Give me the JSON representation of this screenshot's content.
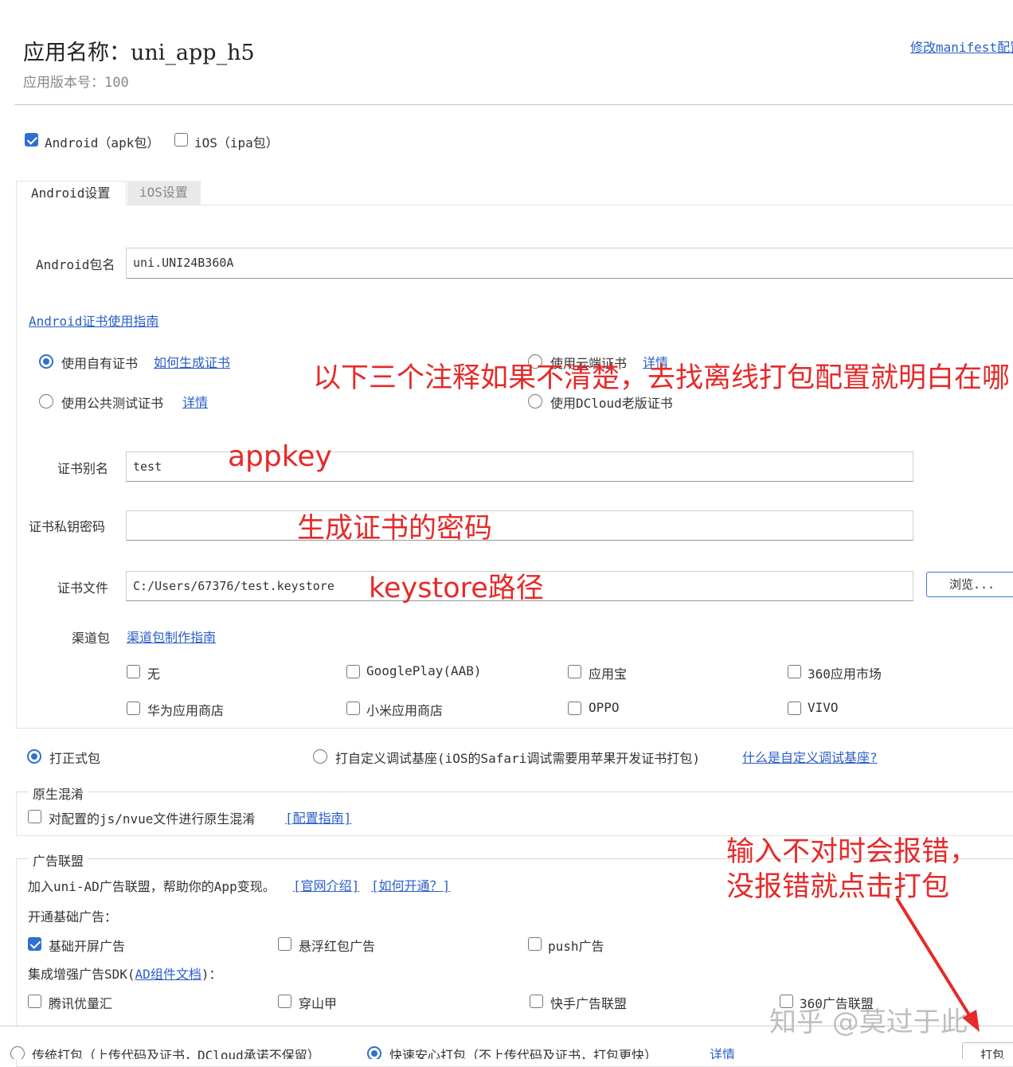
{
  "header": {
    "app_name": "应用名称：uni_app_h5",
    "app_version": "应用版本号：100",
    "manifest_link": "修改manifest配置"
  },
  "platforms": {
    "android_label": "Android（apk包）",
    "android_checked": true,
    "ios_label": "iOS（ipa包）",
    "ios_checked": false
  },
  "tabs": [
    {
      "label": "Android设置",
      "active": true
    },
    {
      "label": "iOS设置",
      "active": false
    }
  ],
  "android": {
    "package_label": "Android包名",
    "package_value": "uni.UNI24B360A",
    "cert_guide_link": "Android证书使用指南",
    "cert_options": {
      "own": {
        "label": "使用自有证书",
        "link": "如何生成证书",
        "selected": true
      },
      "cloud": {
        "label": "使用云端证书",
        "link": "详情",
        "selected": false
      },
      "public": {
        "label": "使用公共测试证书",
        "link": "详情",
        "selected": false
      },
      "dcloud_old": {
        "label": "使用DCloud老版证书",
        "selected": false
      }
    },
    "alias_label": "证书别名",
    "alias_value": "test",
    "password_label": "证书私钥密码",
    "password_value": "",
    "file_label": "证书文件",
    "file_value": "C:/Users/67376/test.keystore",
    "browse_label": "浏览...",
    "channel_label": "渠道包",
    "channel_link": "渠道包制作指南",
    "channels": [
      {
        "label": "无",
        "checked": false
      },
      {
        "label": "GooglePlay(AAB)",
        "checked": false
      },
      {
        "label": "应用宝",
        "checked": false
      },
      {
        "label": "360应用市场",
        "checked": false
      },
      {
        "label": "华为应用商店",
        "checked": false
      },
      {
        "label": "小米应用商店",
        "checked": false
      },
      {
        "label": "OPPO",
        "checked": false
      },
      {
        "label": "VIVO",
        "checked": false
      }
    ]
  },
  "build_type": {
    "formal_label": "打正式包",
    "formal_selected": true,
    "custom_label": "打自定义调试基座(iOS的Safari调试需要用苹果开发证书打包)",
    "custom_selected": false,
    "custom_link": "什么是自定义调试基座?"
  },
  "obfuscation": {
    "legend": "原生混淆",
    "option_label": "对配置的js/nvue文件进行原生混淆",
    "option_checked": false,
    "guide_link": "[配置指南]"
  },
  "ads": {
    "legend": "广告联盟",
    "intro_text": "加入uni-AD广告联盟，帮助你的App变现。",
    "intro_link_1": "[官网介绍]",
    "intro_link_2": "[如何开通？]",
    "basic_label": "开通基础广告：",
    "basic_items": [
      {
        "label": "基础开屏广告",
        "checked": true
      },
      {
        "label": "悬浮红包广告",
        "checked": false
      },
      {
        "label": "push广告",
        "checked": false
      }
    ],
    "sdk_label_pre": "集成增强广告SDK(",
    "sdk_link": "AD组件文档",
    "sdk_label_post": ")：",
    "sdk_items": [
      {
        "label": "腾讯优量汇",
        "checked": false
      },
      {
        "label": "穿山甲",
        "checked": false
      },
      {
        "label": "快手广告联盟",
        "checked": false
      },
      {
        "label": "360广告联盟",
        "checked": false
      }
    ]
  },
  "footer": {
    "traditional_label": "传统打包（上传代码及证书，DCloud承诺不保留）",
    "traditional_selected": false,
    "fast_label": "快速安心打包（不上传代码及证书，打包更快）",
    "fast_selected": true,
    "detail_link": "详情",
    "pack_button": "打包"
  },
  "annotations": {
    "note_top": "以下三个注释如果不清楚，去找离线打包配置就明白在哪",
    "note_appkey": "appkey",
    "note_password": "生成证书的密码",
    "note_keystore": "keystore路径",
    "note_error": "输入不对时会报错，没报错就点击打包"
  },
  "watermark": "知乎 @莫过于此",
  "colors": {
    "accent": "#2f6fd0",
    "link": "#2a5dc9",
    "annotation": "#e52a2a"
  }
}
